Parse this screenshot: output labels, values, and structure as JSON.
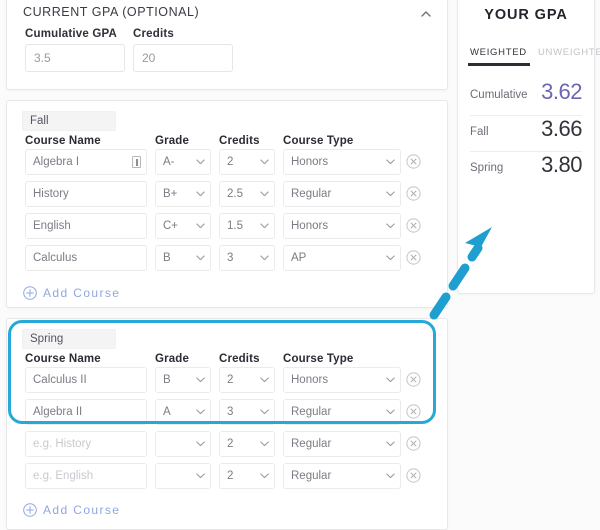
{
  "current_gpa": {
    "title": "CURRENT GPA (OPTIONAL)",
    "collapse_icon": "chevron-up-icon",
    "cumulative_label": "Cumulative GPA",
    "cumulative_value": "3.5",
    "credits_label": "Credits",
    "credits_value": "20"
  },
  "columns": {
    "course_name": "Course Name",
    "grade": "Grade",
    "credits": "Credits",
    "course_type": "Course Type"
  },
  "add_course_label": "Add Course",
  "terms": [
    {
      "name": "Fall",
      "courses": [
        {
          "name": "Algebra I",
          "name_is_placeholder": false,
          "grade": "A-",
          "credits": "2",
          "type": "Honors",
          "has_cursor_icon": true
        },
        {
          "name": "History",
          "name_is_placeholder": false,
          "grade": "B+",
          "credits": "2.5",
          "type": "Regular",
          "has_cursor_icon": false
        },
        {
          "name": "English",
          "name_is_placeholder": false,
          "grade": "C+",
          "credits": "1.5",
          "type": "Honors",
          "has_cursor_icon": false
        },
        {
          "name": "Calculus",
          "name_is_placeholder": false,
          "grade": "B",
          "credits": "3",
          "type": "AP",
          "has_cursor_icon": false
        }
      ]
    },
    {
      "name": "Spring",
      "courses": [
        {
          "name": "Calculus II",
          "name_is_placeholder": false,
          "grade": "B",
          "credits": "2",
          "type": "Honors",
          "has_cursor_icon": false
        },
        {
          "name": "Algebra II",
          "name_is_placeholder": false,
          "grade": "A",
          "credits": "3",
          "type": "Regular",
          "has_cursor_icon": false
        },
        {
          "name": "e.g. History",
          "name_is_placeholder": true,
          "grade": "",
          "credits": "2",
          "type": "Regular",
          "has_cursor_icon": false
        },
        {
          "name": "e.g. English",
          "name_is_placeholder": true,
          "grade": "",
          "credits": "2",
          "type": "Regular",
          "has_cursor_icon": false
        }
      ]
    }
  ],
  "gpa_panel": {
    "title": "YOUR GPA",
    "tabs": [
      {
        "label": "WEIGHTED",
        "active": true
      },
      {
        "label": "UNWEIGHTED",
        "active": false
      }
    ],
    "rows": [
      {
        "label": "Cumulative",
        "value": "3.62",
        "color": "#6b66b5"
      },
      {
        "label": "Fall",
        "value": "3.66",
        "color": "#33333a"
      },
      {
        "label": "Spring",
        "value": "3.80",
        "color": "#33333a"
      }
    ]
  },
  "annotation": {
    "highlight_color": "#26a9d8",
    "arrow_color": "#1f9fd0",
    "arrow_style": "dashed-arrow-pointing-up-right"
  }
}
